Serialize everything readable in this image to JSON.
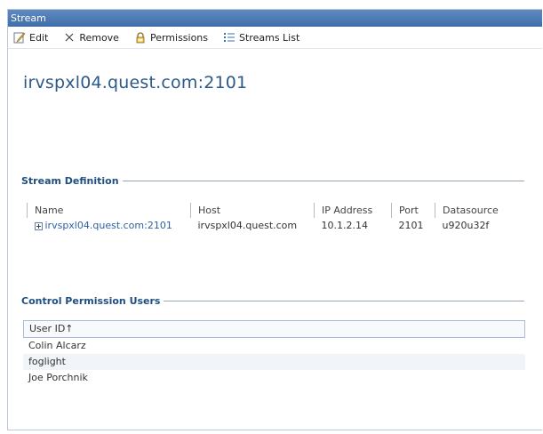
{
  "window": {
    "title": "Stream"
  },
  "toolbar": {
    "edit": "Edit",
    "remove": "Remove",
    "permissions": "Permissions",
    "streams_list": "Streams List"
  },
  "headline": "irvspxl04.quest.com:2101",
  "stream_definition": {
    "title": "Stream Definition",
    "columns": [
      "Name",
      "Host",
      "IP Address",
      "Port",
      "Datasource"
    ],
    "row": {
      "name": "irvspxl04.quest.com:2101",
      "host": "irvspxl04.quest.com",
      "ip": "10.1.2.14",
      "port": "2101",
      "datasource": "u920u32f"
    }
  },
  "control_permission_users": {
    "title": "Control Permission Users",
    "header": "User ID↑",
    "users": [
      "Colin Alcarz",
      "foglight",
      "Joe Porchnik"
    ]
  }
}
